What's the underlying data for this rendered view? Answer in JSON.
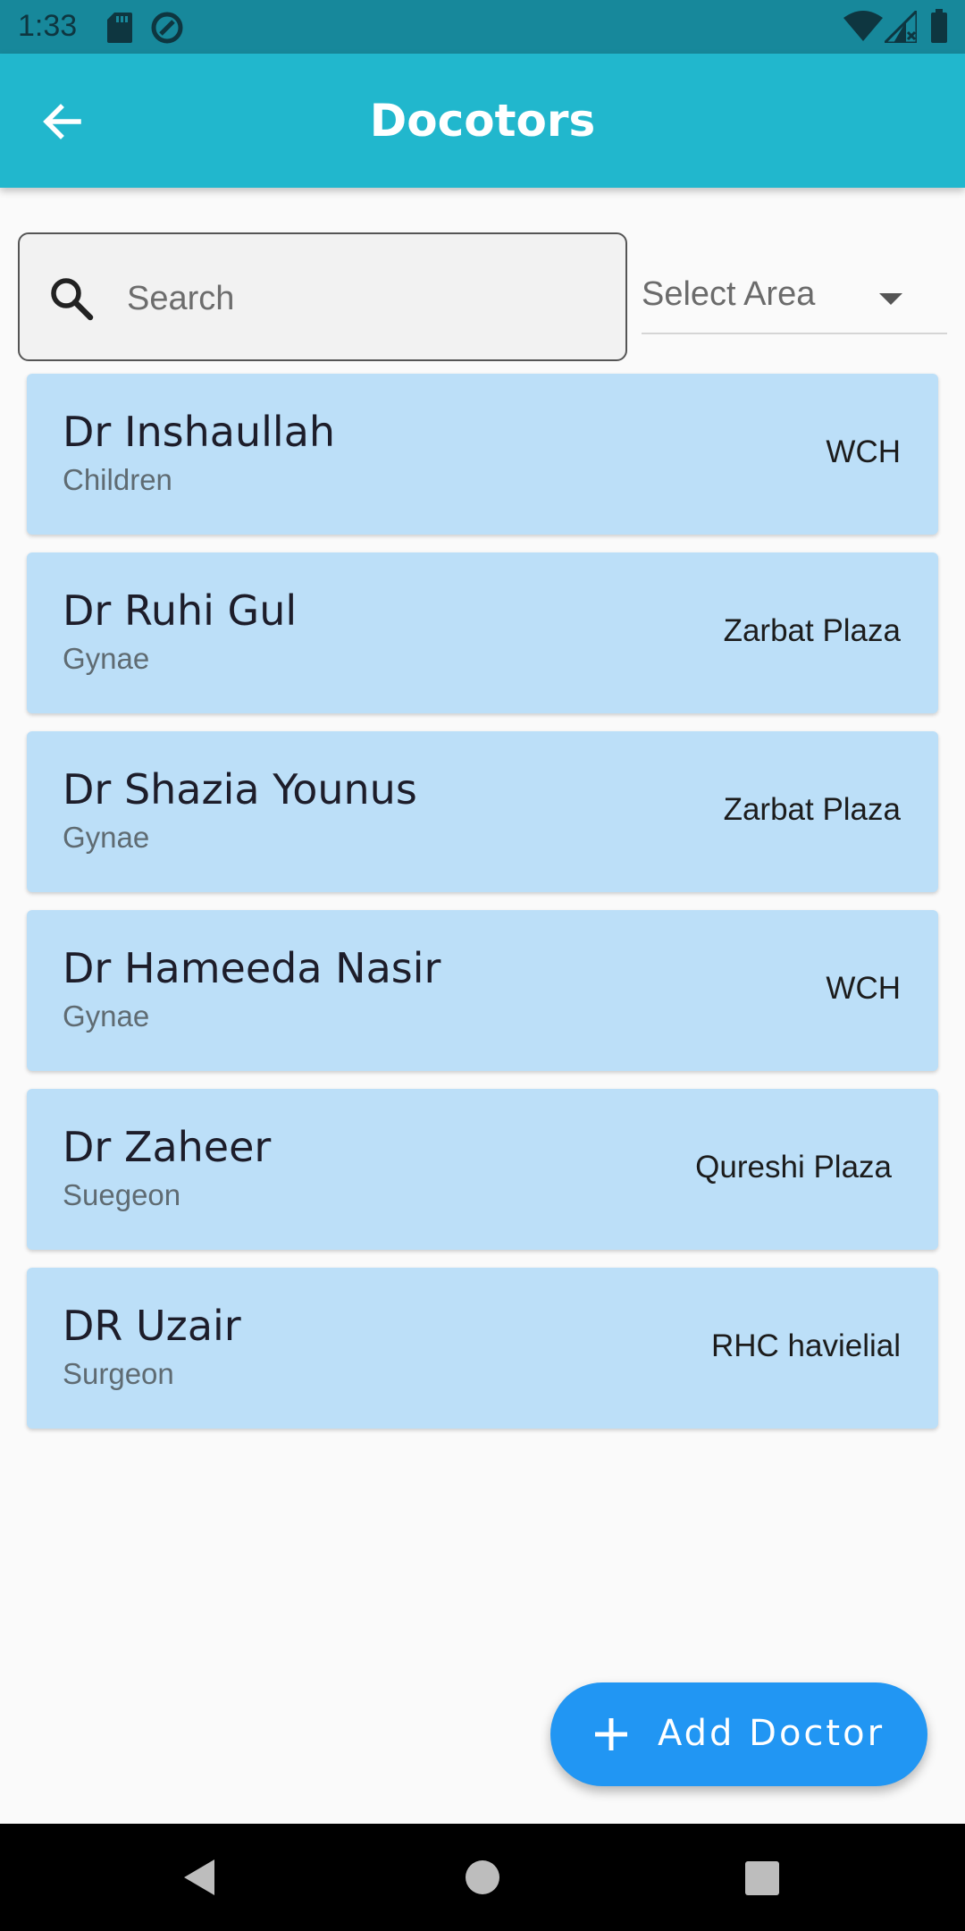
{
  "status_bar": {
    "time": "1:33",
    "icons": [
      "sd-card-icon",
      "sync-icon",
      "wifi-icon",
      "cell-signal-icon",
      "battery-icon"
    ]
  },
  "app_bar": {
    "title": "Docotors",
    "back_icon": "arrow-left-icon",
    "background": "#21b7cd"
  },
  "search": {
    "placeholder": "Search",
    "value": ""
  },
  "area_filter": {
    "label": "Select Area"
  },
  "doctors": [
    {
      "name": "Dr Inshaullah",
      "specialty": "Children",
      "area": "WCH"
    },
    {
      "name": "Dr Ruhi Gul",
      "specialty": "Gynae",
      "area": "Zarbat Plaza"
    },
    {
      "name": "Dr Shazia Younus",
      "specialty": "Gynae",
      "area": "Zarbat Plaza"
    },
    {
      "name": "Dr Hameeda Nasir",
      "specialty": "Gynae",
      "area": "WCH"
    },
    {
      "name": "Dr Zaheer",
      "specialty": "Suegeon",
      "area": "Qureshi Plaza"
    },
    {
      "name": "DR Uzair",
      "specialty": "Surgeon",
      "area": "RHC havielial"
    }
  ],
  "fab": {
    "label": "Add Doctor",
    "icon": "plus-icon",
    "color": "#2196f3"
  },
  "colors": {
    "card": "#bcdff8",
    "status_bar": "#17889b"
  }
}
